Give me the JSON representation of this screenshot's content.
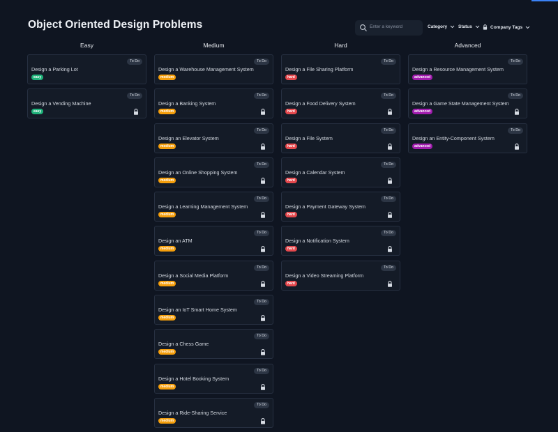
{
  "page": {
    "title": "Object Oriented Design Problems"
  },
  "toolbar": {
    "search_placeholder": "Enter a keyword",
    "category_label": "Category",
    "status_label": "Status",
    "company_tags_label": "Company Tags"
  },
  "colors": {
    "easy": "#1fb27a",
    "medium": "#f59e0b",
    "hard": "#e5484d",
    "advanced": "#a21caf"
  },
  "columns": [
    {
      "title": "Easy",
      "level": "easy",
      "cards": [
        {
          "title": "Design a Parking Lot",
          "status": "To Do",
          "difficulty": "easy",
          "locked": false
        },
        {
          "title": "Design a Vending Machine",
          "status": "To Do",
          "difficulty": "easy",
          "locked": true
        }
      ]
    },
    {
      "title": "Medium",
      "level": "medium",
      "cards": [
        {
          "title": "Design a Warehouse Management System",
          "status": "To Do",
          "difficulty": "medium",
          "locked": false
        },
        {
          "title": "Design a Banking System",
          "status": "To Do",
          "difficulty": "medium",
          "locked": true
        },
        {
          "title": "Design an Elevator System",
          "status": "To Do",
          "difficulty": "medium",
          "locked": true
        },
        {
          "title": "Design an Online Shopping System",
          "status": "To Do",
          "difficulty": "medium",
          "locked": true
        },
        {
          "title": "Design a Learning Management System",
          "status": "To Do",
          "difficulty": "medium",
          "locked": true
        },
        {
          "title": "Design an ATM",
          "status": "To Do",
          "difficulty": "medium",
          "locked": true
        },
        {
          "title": "Design a Social Media Platform",
          "status": "To Do",
          "difficulty": "medium",
          "locked": true
        },
        {
          "title": "Design an IoT Smart Home System",
          "status": "To Do",
          "difficulty": "medium",
          "locked": true
        },
        {
          "title": "Design a Chess Game",
          "status": "To Do",
          "difficulty": "medium",
          "locked": true
        },
        {
          "title": "Design a Hotel Booking System",
          "status": "To Do",
          "difficulty": "medium",
          "locked": true
        },
        {
          "title": "Design a Ride-Sharing Service",
          "status": "To Do",
          "difficulty": "medium",
          "locked": true
        }
      ]
    },
    {
      "title": "Hard",
      "level": "hard",
      "cards": [
        {
          "title": "Design a File Sharing Platform",
          "status": "To Do",
          "difficulty": "hard",
          "locked": false
        },
        {
          "title": "Design a Food Delivery System",
          "status": "To Do",
          "difficulty": "hard",
          "locked": true
        },
        {
          "title": "Design a File System",
          "status": "To Do",
          "difficulty": "hard",
          "locked": true
        },
        {
          "title": "Design a Calendar System",
          "status": "To Do",
          "difficulty": "hard",
          "locked": true
        },
        {
          "title": "Design a Payment Gateway System",
          "status": "To Do",
          "difficulty": "hard",
          "locked": true
        },
        {
          "title": "Design a Notification System",
          "status": "To Do",
          "difficulty": "hard",
          "locked": true
        },
        {
          "title": "Design a Video Streaming Platform",
          "status": "To Do",
          "difficulty": "hard",
          "locked": true
        }
      ]
    },
    {
      "title": "Advanced",
      "level": "advanced",
      "cards": [
        {
          "title": "Design a Resource Management System",
          "status": "To Do",
          "difficulty": "advanced",
          "locked": false
        },
        {
          "title": "Design a Game State Management System",
          "status": "To Do",
          "difficulty": "advanced",
          "locked": true
        },
        {
          "title": "Design an Entity-Component System",
          "status": "To Do",
          "difficulty": "advanced",
          "locked": true
        }
      ]
    }
  ]
}
